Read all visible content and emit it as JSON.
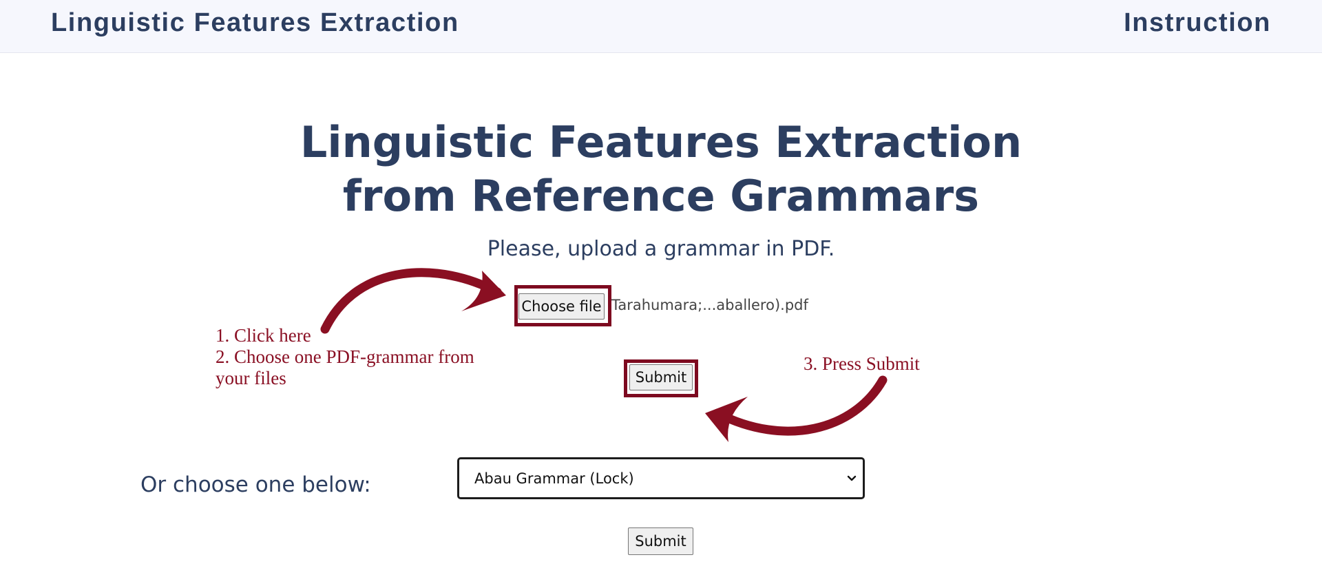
{
  "header": {
    "brand": "Linguistic Features Extraction",
    "nav_instruction": "Instruction"
  },
  "main": {
    "title_line1": "Linguistic Features Extraction",
    "title_line2": "from Reference Grammars",
    "subtitle": "Please, upload a grammar in PDF."
  },
  "upload": {
    "choose_file_label": "Choose file",
    "file_name": "Tarahumara;...aballero).pdf",
    "submit_label": "Submit"
  },
  "annotations": {
    "step1": "1. Click here",
    "step2_line1": "2. Choose one PDF-grammar from",
    "step2_line2": "your files",
    "step3": "3. Press Submit",
    "color": "#8a1024"
  },
  "select_section": {
    "label": "Or choose one below:",
    "selected_value": "Abau Grammar (Lock)",
    "submit_label": "Submit"
  },
  "icons": {
    "dropdown": "chevron-down-icon",
    "arrow_to_file": "curved-arrow-icon",
    "arrow_to_submit": "curved-arrow-icon"
  },
  "colors": {
    "text_primary": "#2c3e60",
    "header_bg": "#f6f7fd",
    "highlight_border": "#7d0a20"
  }
}
